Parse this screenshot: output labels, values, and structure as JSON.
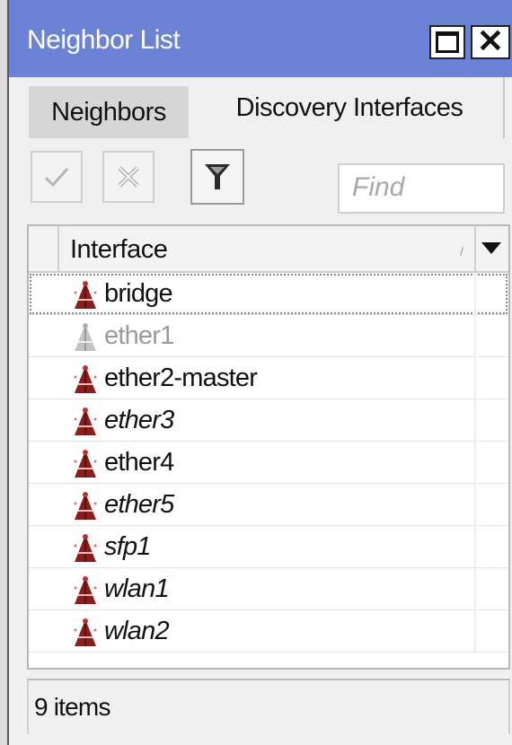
{
  "window": {
    "title": "Neighbor List"
  },
  "tabs": [
    {
      "label": "Neighbors",
      "active": false
    },
    {
      "label": "Discovery Interfaces",
      "active": true
    }
  ],
  "toolbar": {
    "enable_icon": "checkmark-icon",
    "disable_icon": "x-icon",
    "filter_icon": "filter-icon",
    "find_placeholder": "Find"
  },
  "table": {
    "columns": [
      "Interface"
    ],
    "rows": [
      {
        "name": "bridge",
        "style": "normal",
        "icon": "antenna-icon",
        "selected": true
      },
      {
        "name": "ether1",
        "style": "disabled",
        "icon": "antenna-icon-gray"
      },
      {
        "name": "ether2-master",
        "style": "normal",
        "icon": "antenna-icon"
      },
      {
        "name": "ether3",
        "style": "italic",
        "icon": "antenna-icon"
      },
      {
        "name": "ether4",
        "style": "normal",
        "icon": "antenna-icon"
      },
      {
        "name": "ether5",
        "style": "italic",
        "icon": "antenna-icon"
      },
      {
        "name": "sfp1",
        "style": "italic",
        "icon": "antenna-icon"
      },
      {
        "name": "wlan1",
        "style": "italic",
        "icon": "antenna-icon"
      },
      {
        "name": "wlan2",
        "style": "italic",
        "icon": "antenna-icon"
      }
    ]
  },
  "status": {
    "text": "9 items"
  },
  "colors": {
    "titlebar": "#6c82d4",
    "icon": "#8c1d1d",
    "icon_disabled": "#b0b0b0"
  }
}
